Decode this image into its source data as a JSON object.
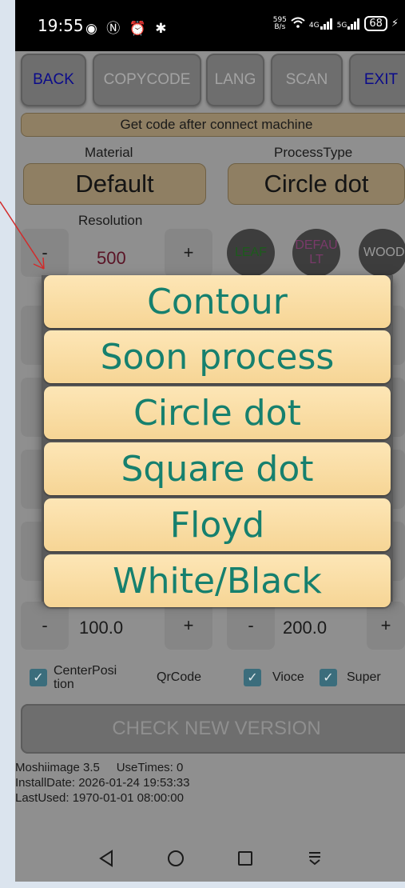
{
  "status_bar": {
    "time": "19:55",
    "left_icons": "◉ Ⓝ ⏰ ✱",
    "net_speed_value": "595",
    "net_speed_unit": "B/s",
    "signal1": "4G",
    "signal2": "5G",
    "battery": "68"
  },
  "toolbar": {
    "back": "BACK",
    "copycode": "COPYCODE",
    "lang": "LANG",
    "scan": "SCAN",
    "exit": "EXIT"
  },
  "notice": "Get code after connect machine",
  "material": {
    "label": "Material",
    "value": "Default"
  },
  "process_type": {
    "label": "ProcessType",
    "value": "Circle dot"
  },
  "resolution": {
    "label": "Resolution",
    "minus": "-",
    "value": "500",
    "plus": "+"
  },
  "presets": {
    "leaf": "LEAF",
    "default": "DEFAU\nLT",
    "wood": "WOOD"
  },
  "row_left_value": "100.0",
  "row_right_value": "200.0",
  "row_minus": "-",
  "row_plus": "+",
  "popup_options": [
    "Contour",
    "Soon process",
    "Circle dot",
    "Square dot",
    "Floyd",
    "White/Black"
  ],
  "checks": {
    "center_position": "CenterPosi\ntion",
    "qrcode": "QrCode",
    "vioce": "Vioce",
    "super": "Super"
  },
  "check_version": "CHECK NEW VERSION",
  "info": {
    "line1": "Moshiimage 3.5     UseTimes: 0",
    "line2": "InstallDate: 2026-01-24 19:53:33",
    "line3": "LastUsed: 1970-01-01 08:00:00"
  },
  "colors": {
    "popup_text": "#16806e",
    "overlay_dim": "#8f8f8f",
    "arrow": "#d22b2b"
  }
}
